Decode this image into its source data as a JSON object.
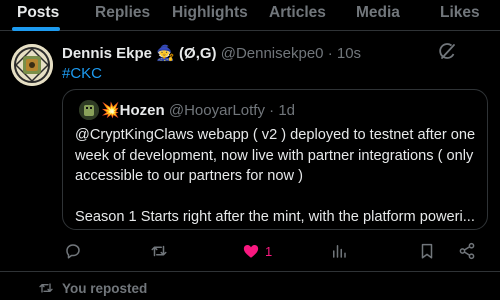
{
  "tabs": [
    {
      "label": "Posts",
      "active": true
    },
    {
      "label": "Replies",
      "active": false
    },
    {
      "label": "Highlights",
      "active": false
    },
    {
      "label": "Articles",
      "active": false
    },
    {
      "label": "Media",
      "active": false
    },
    {
      "label": "Likes",
      "active": false
    }
  ],
  "post": {
    "display_name": "Dennis Ekpe 🧙 (Ø,G)",
    "handle": "@Dennisekpe0",
    "separator": "·",
    "time": "10s",
    "hashtag": "#CKC",
    "more_icon": "grok-icon"
  },
  "quote": {
    "display_name": "💥Hozen",
    "handle": "@HooyarLotfy",
    "separator": "·",
    "time": "1d",
    "lines": [
      "@CryptKingClaws  webapp ( v2 ) deployed to testnet after one",
      "week of development, now live with partner integrations ( only",
      "accessible to our partners for now )"
    ],
    "line4": "Season 1 Starts right after the mint, with the platform poweri..."
  },
  "actions": {
    "reply_icon": "reply-icon",
    "repost_icon": "repost-icon",
    "like_icon": "heart-icon",
    "like_count": "1",
    "like_color": "#f91880",
    "views_icon": "views-icon",
    "bookmark_icon": "bookmark-icon",
    "share_icon": "share-icon"
  },
  "next": {
    "repost_label": "You reposted"
  },
  "colors": {
    "accent": "#1d9bf0",
    "muted": "#71767b",
    "background": "#000000",
    "border": "#2f3336"
  }
}
